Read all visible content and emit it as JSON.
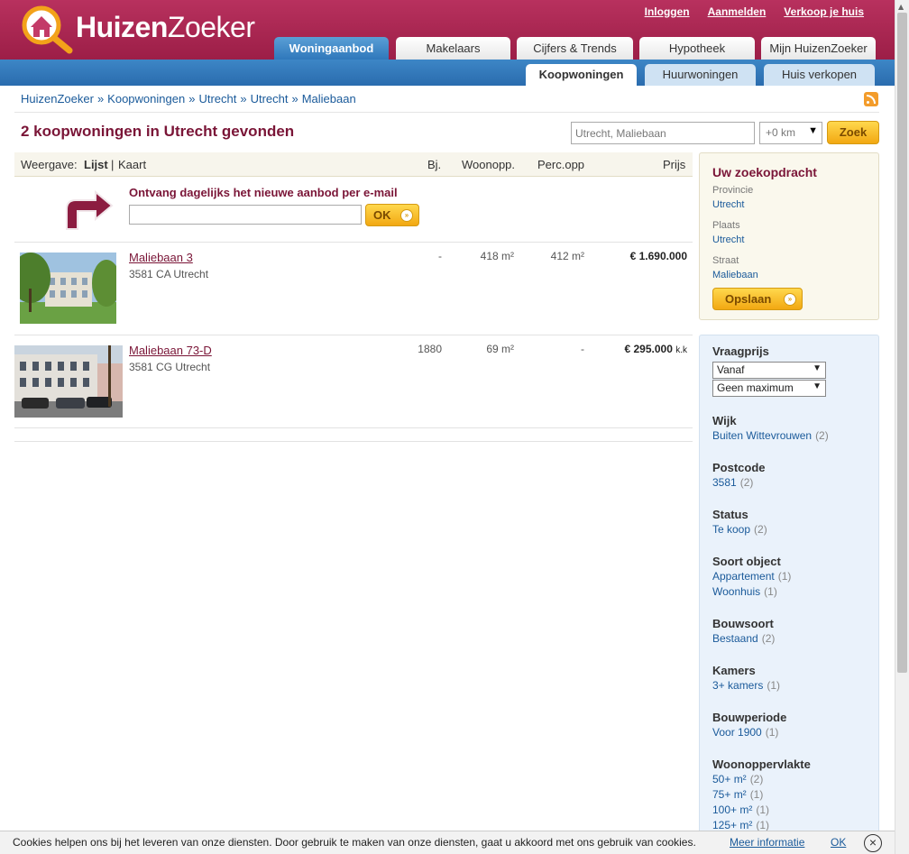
{
  "header": {
    "logo_text_bold": "Huizen",
    "logo_text_light": "Zoeker",
    "top_links": [
      "Inloggen",
      "Aanmelden",
      "Verkoop je huis"
    ]
  },
  "main_tabs": [
    {
      "label": "Woningaanbod",
      "active": true
    },
    {
      "label": "Makelaars",
      "active": false
    },
    {
      "label": "Cijfers & Trends",
      "active": false
    },
    {
      "label": "Hypotheek",
      "active": false
    },
    {
      "label": "Mijn HuizenZoeker",
      "active": false
    }
  ],
  "sub_tabs": [
    {
      "label": "Koopwoningen",
      "active": true
    },
    {
      "label": "Huurwoningen",
      "active": false
    },
    {
      "label": "Huis verkopen",
      "active": false
    }
  ],
  "breadcrumb": [
    "HuizenZoeker",
    "Koopwoningen",
    "Utrecht",
    "Utrecht",
    "Maliebaan"
  ],
  "breadcrumb_sep": "»",
  "heading": "2 koopwoningen in Utrecht gevonden",
  "search": {
    "value": "Utrecht, Maliebaan",
    "radius": "+0 km",
    "button": "Zoek"
  },
  "results_header": {
    "view_label": "Weergave:",
    "view_list": "Lijst",
    "view_sep": "|",
    "view_map": "Kaart",
    "col_year": "Bj.",
    "col_living": "Woonopp.",
    "col_plot": "Perc.opp",
    "col_price": "Prijs"
  },
  "email_alert": {
    "text": "Ontvang dagelijks het nieuwe aanbod per e-mail",
    "button": "OK"
  },
  "listings": [
    {
      "title": "Maliebaan 3",
      "address": "3581 CA Utrecht",
      "year": "-",
      "living": "418 m²",
      "plot": "412 m²",
      "price": "€ 1.690.000",
      "price_suffix": ""
    },
    {
      "title": "Maliebaan 73-D",
      "address": "3581 CG Utrecht",
      "year": "1880",
      "living": "69 m²",
      "plot": "-",
      "price": "€ 295.000",
      "price_suffix": "k.k"
    }
  ],
  "saved_search": {
    "title": "Uw zoekopdracht",
    "fields": [
      {
        "label": "Provincie",
        "value": "Utrecht"
      },
      {
        "label": "Plaats",
        "value": "Utrecht"
      },
      {
        "label": "Straat",
        "value": "Maliebaan"
      }
    ],
    "button": "Opslaan"
  },
  "filters": {
    "price_title": "Vraagprijs",
    "price_from": "Vanaf",
    "price_to": "Geen maximum",
    "groups": [
      {
        "title": "Wijk",
        "options": [
          {
            "label": "Buiten Wittevrouwen",
            "count": "(2)"
          }
        ]
      },
      {
        "title": "Postcode",
        "options": [
          {
            "label": "3581",
            "count": "(2)"
          }
        ]
      },
      {
        "title": "Status",
        "options": [
          {
            "label": "Te koop",
            "count": "(2)"
          }
        ]
      },
      {
        "title": "Soort object",
        "options": [
          {
            "label": "Appartement",
            "count": "(1)"
          },
          {
            "label": "Woonhuis",
            "count": "(1)"
          }
        ]
      },
      {
        "title": "Bouwsoort",
        "options": [
          {
            "label": "Bestaand",
            "count": "(2)"
          }
        ]
      },
      {
        "title": "Kamers",
        "options": [
          {
            "label": "3+ kamers",
            "count": "(1)"
          }
        ]
      },
      {
        "title": "Bouwperiode",
        "options": [
          {
            "label": "Voor 1900",
            "count": "(1)"
          }
        ]
      },
      {
        "title": "Woonoppervlakte",
        "options": [
          {
            "label": "50+ m²",
            "count": "(2)"
          },
          {
            "label": "75+ m²",
            "count": "(1)"
          },
          {
            "label": "100+ m²",
            "count": "(1)"
          },
          {
            "label": "125+ m²",
            "count": "(1)"
          }
        ]
      }
    ]
  },
  "cookie_bar": {
    "text": "Cookies helpen ons bij het leveren van onze diensten. Door gebruik te maken van onze diensten, gaat u akkoord met ons gebruik van cookies.",
    "more": "Meer informatie",
    "ok": "OK",
    "close": "×"
  }
}
